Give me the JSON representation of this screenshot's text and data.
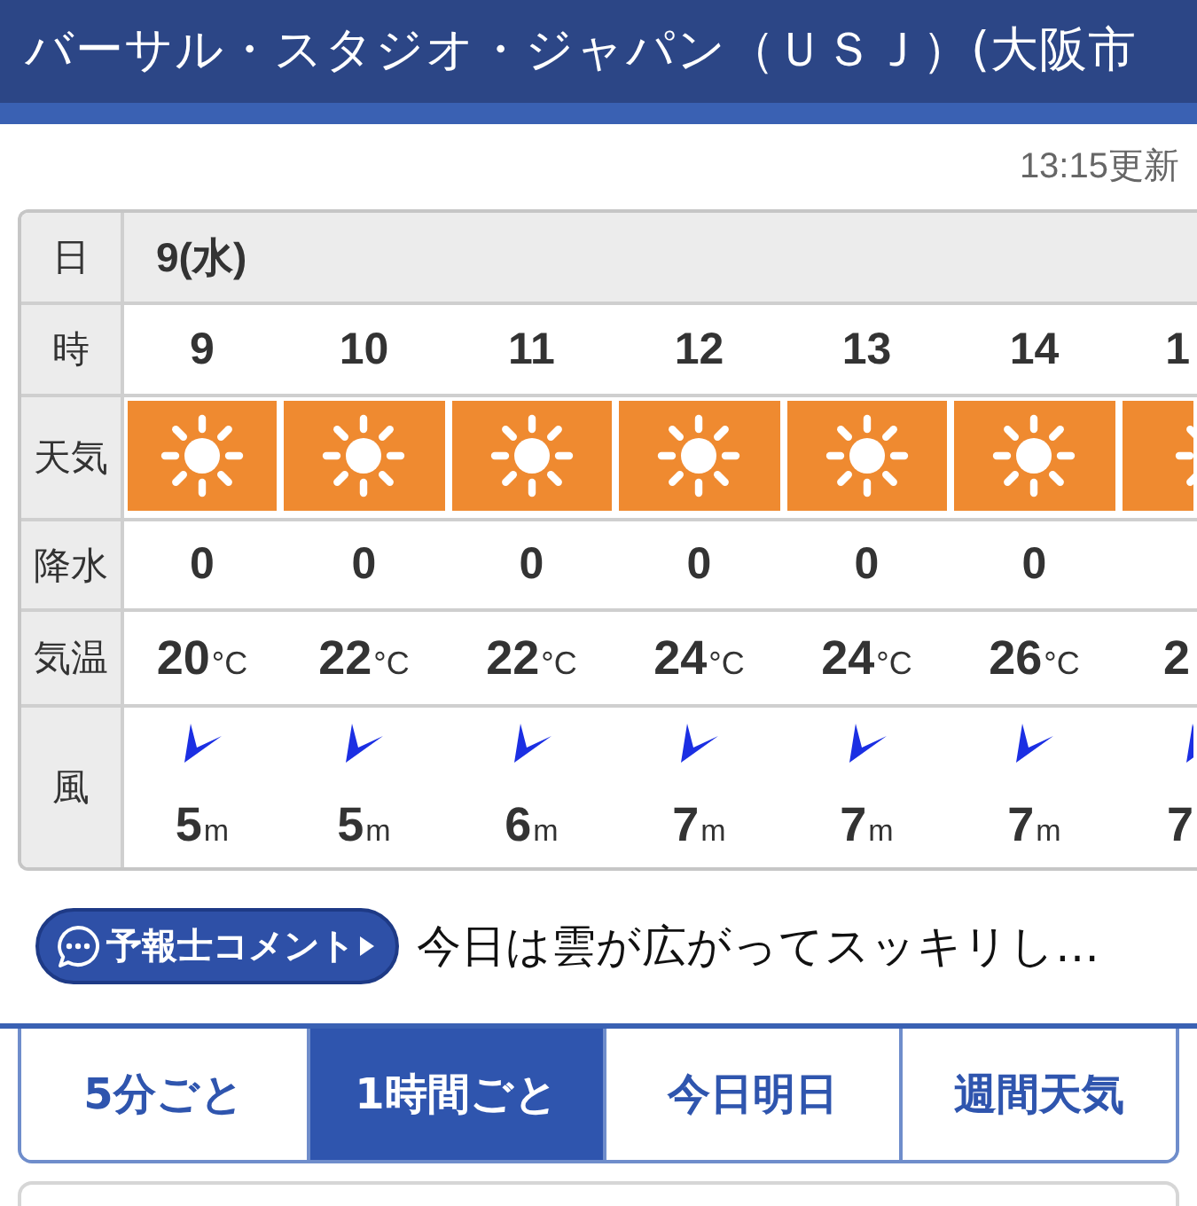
{
  "header": {
    "title": "バーサル・スタジオ・ジャパン（ＵＳＪ）(大阪市"
  },
  "updated": "13:15更新",
  "forecast": {
    "row_headers": [
      "日",
      "時",
      "天気",
      "降水",
      "気温",
      "風"
    ],
    "date": "9(水)",
    "columns": [
      {
        "hour": "9",
        "weather": {
          "kind": "sunny"
        },
        "precip": "0",
        "temp": "20",
        "temp_unit": "°C",
        "wind_arrow": {
          "kind": "southwest"
        },
        "wind_speed": "5",
        "wind_unit": "m",
        "cut_off": false
      },
      {
        "hour": "10",
        "weather": {
          "kind": "sunny"
        },
        "precip": "0",
        "temp": "22",
        "temp_unit": "°C",
        "wind_arrow": {
          "kind": "southwest"
        },
        "wind_speed": "5",
        "wind_unit": "m",
        "cut_off": false
      },
      {
        "hour": "11",
        "weather": {
          "kind": "sunny"
        },
        "precip": "0",
        "temp": "22",
        "temp_unit": "°C",
        "wind_arrow": {
          "kind": "southwest"
        },
        "wind_speed": "6",
        "wind_unit": "m",
        "cut_off": false
      },
      {
        "hour": "12",
        "weather": {
          "kind": "sunny"
        },
        "precip": "0",
        "temp": "24",
        "temp_unit": "°C",
        "wind_arrow": {
          "kind": "southwest"
        },
        "wind_speed": "7",
        "wind_unit": "m",
        "cut_off": false
      },
      {
        "hour": "13",
        "weather": {
          "kind": "sunny"
        },
        "precip": "0",
        "temp": "24",
        "temp_unit": "°C",
        "wind_arrow": {
          "kind": "southwest"
        },
        "wind_speed": "7",
        "wind_unit": "m",
        "cut_off": false
      },
      {
        "hour": "14",
        "weather": {
          "kind": "sunny"
        },
        "precip": "0",
        "temp": "26",
        "temp_unit": "°C",
        "wind_arrow": {
          "kind": "southwest"
        },
        "wind_speed": "7",
        "wind_unit": "m",
        "cut_off": false
      },
      {
        "hour": "1",
        "weather": {
          "kind": "sunny"
        },
        "temp": "2",
        "wind_arrow": {
          "kind": "southwest"
        },
        "wind_speed": "7",
        "cut_off": true
      }
    ]
  },
  "comment": {
    "button": "予報士コメント",
    "text": "今日は雲が広がってスッキリし…"
  },
  "tabs": [
    {
      "label": "5分ごと",
      "selected": false
    },
    {
      "label": "1時間ごと",
      "selected": true
    },
    {
      "label": "今日明日",
      "selected": false
    },
    {
      "label": "週間天気",
      "selected": false
    }
  ]
}
